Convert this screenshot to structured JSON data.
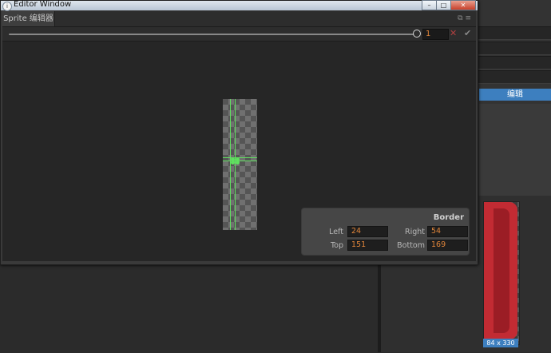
{
  "window": {
    "title": "Editor Window",
    "icon": "info-circle-icon",
    "controls": {
      "minimize": "–",
      "maximize": "□",
      "close": "✕"
    }
  },
  "tab": {
    "label": "Sprite 编辑器",
    "icons": "⧉ ≡"
  },
  "toolbar": {
    "zoom_value": "1",
    "cancel_glyph": "✕",
    "confirm_glyph": "✔"
  },
  "border": {
    "title": "Border",
    "left_label": "Left",
    "left": "24",
    "right_label": "Right",
    "right": "54",
    "top_label": "Top",
    "top": "151",
    "bottom_label": "Bottom",
    "bottom": "169"
  },
  "right_panel": {
    "edit_button": "编辑",
    "preview_size": "84 x 330"
  },
  "colors": {
    "accent": "#3d7fbf",
    "value": "#e0853a",
    "guide": "#5fe05f",
    "sprite_red": "#c22b33"
  }
}
